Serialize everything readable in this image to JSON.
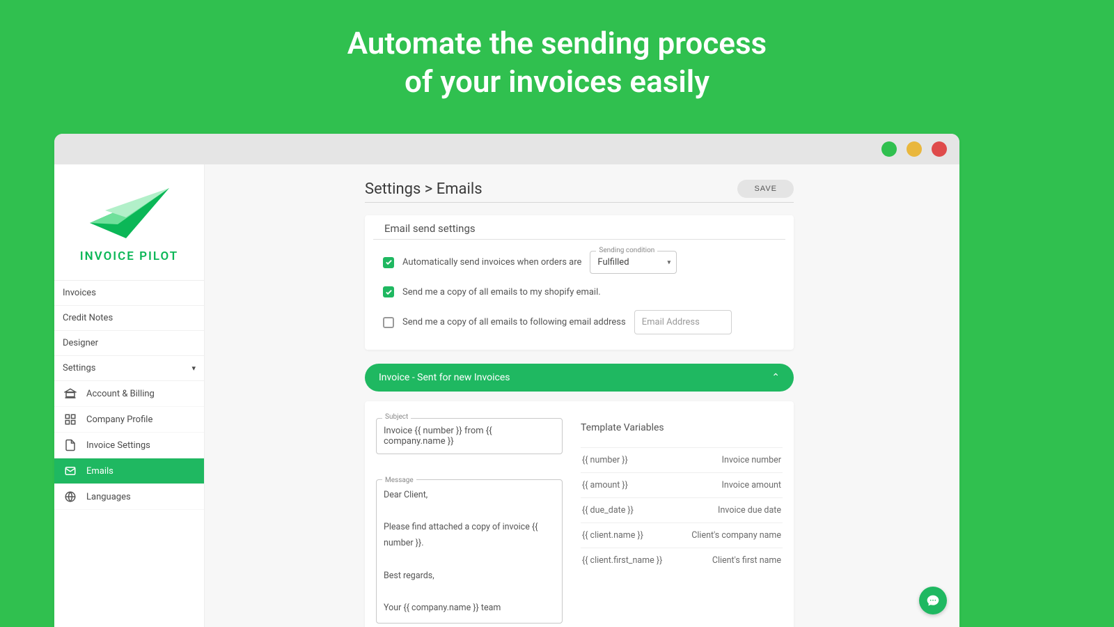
{
  "hero": {
    "line1": "Automate the sending process",
    "line2": "of your invoices easily"
  },
  "brand": {
    "name": "INVOICE PILOT"
  },
  "nav": {
    "items": [
      {
        "label": "Invoices"
      },
      {
        "label": "Credit Notes"
      },
      {
        "label": "Designer"
      },
      {
        "label": "Settings"
      }
    ],
    "sub": [
      {
        "label": "Account & Billing"
      },
      {
        "label": "Company Profile"
      },
      {
        "label": "Invoice Settings"
      },
      {
        "label": "Emails"
      },
      {
        "label": "Languages"
      }
    ]
  },
  "page": {
    "breadcrumb": "Settings > Emails",
    "save": "SAVE"
  },
  "sendSettings": {
    "title": "Email send settings",
    "auto_label": "Automatically send invoices when orders are",
    "condition_label": "Sending condition",
    "condition_value": "Fulfilled",
    "copy_shopify": "Send me a copy of all emails to my shopify email.",
    "copy_custom": "Send me a copy of all emails to following email address",
    "email_placeholder": "Email Address"
  },
  "accordion": {
    "title": "Invoice - Sent for new Invoices"
  },
  "template": {
    "subject_label": "Subject",
    "subject_value": "Invoice {{ number }} from {{ company.name }}",
    "message_label": "Message",
    "message_l1": "Dear Client,",
    "message_l2": "Please find attached a copy of invoice {{ number }}.",
    "message_l3": "Best regards,",
    "message_l4": "Your {{ company.name }} team",
    "vars_title": "Template Variables",
    "vars": [
      {
        "k": "{{ number }}",
        "v": "Invoice number"
      },
      {
        "k": "{{ amount }}",
        "v": "Invoice amount"
      },
      {
        "k": "{{ due_date }}",
        "v": "Invoice due date"
      },
      {
        "k": "{{ client.name }}",
        "v": "Client's company name"
      },
      {
        "k": "{{ client.first_name }}",
        "v": "Client's first name"
      }
    ]
  }
}
